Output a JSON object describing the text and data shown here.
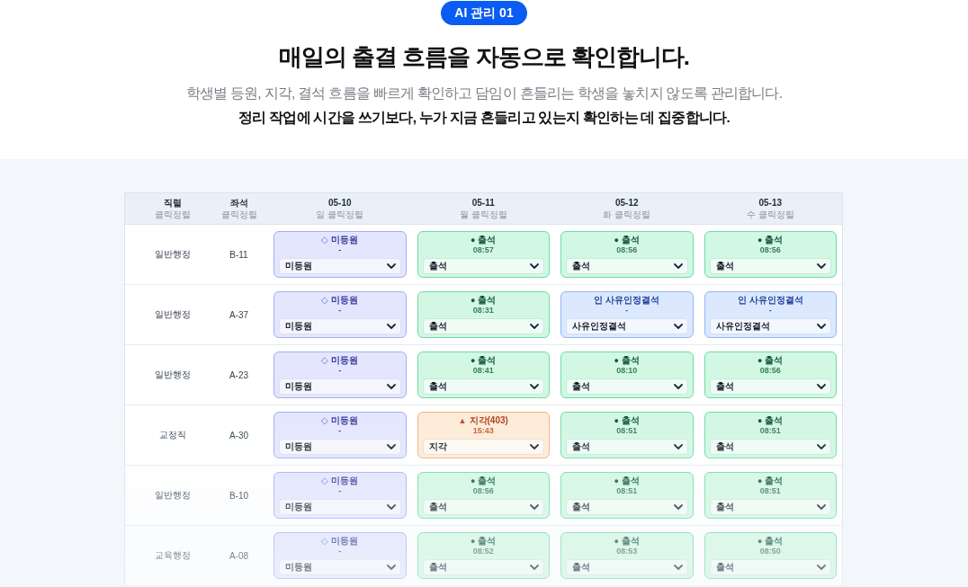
{
  "badge": "AI 관리 01",
  "title": "매일의 출결 흐름을 자동으로 확인합니다.",
  "subtitle": "학생별 등원, 지각, 결석 흐름을 빠르게 확인하고 담임이 흔들리는 학생을 놓치지 않도록 관리합니다.",
  "emphasis": "정리 작업에 시간을 쓰기보다, 누가 지금 흔들리고 있는지 확인하는 데 집중합니다.",
  "table": {
    "columns": [
      {
        "label": "직렬",
        "sub": "클릭정렬"
      },
      {
        "label": "좌석",
        "sub": "클릭정렬"
      },
      {
        "label": "05-10",
        "sub": "일 클릭정렬"
      },
      {
        "label": "05-11",
        "sub": "월 클릭정렬"
      },
      {
        "label": "05-12",
        "sub": "화 클릭정렬"
      },
      {
        "label": "05-13",
        "sub": "수 클릭정렬"
      }
    ],
    "rows": [
      {
        "job_series": "일반행정",
        "seat": "B-11",
        "days": [
          {
            "kind": "pending",
            "mark": "◇",
            "label": "미등원",
            "time": "-",
            "value": "미등원"
          },
          {
            "kind": "present",
            "mark": "●",
            "label": "출석",
            "time": "08:57",
            "value": "출석"
          },
          {
            "kind": "present",
            "mark": "●",
            "label": "출석",
            "time": "08:56",
            "value": "출석"
          },
          {
            "kind": "present",
            "mark": "●",
            "label": "출석",
            "time": "08:56",
            "value": "출석"
          }
        ]
      },
      {
        "job_series": "일반행정",
        "seat": "A-37",
        "days": [
          {
            "kind": "pending",
            "mark": "◇",
            "label": "미등원",
            "time": "-",
            "value": "미등원"
          },
          {
            "kind": "present",
            "mark": "●",
            "label": "출석",
            "time": "08:31",
            "value": "출석"
          },
          {
            "kind": "excused",
            "mark": "인",
            "label": "사유인정결석",
            "time": "-",
            "value": "사유인정결석"
          },
          {
            "kind": "excused",
            "mark": "인",
            "label": "사유인정결석",
            "time": "-",
            "value": "사유인정결석"
          }
        ]
      },
      {
        "job_series": "일반행정",
        "seat": "A-23",
        "days": [
          {
            "kind": "pending",
            "mark": "◇",
            "label": "미등원",
            "time": "-",
            "value": "미등원"
          },
          {
            "kind": "present",
            "mark": "●",
            "label": "출석",
            "time": "08:41",
            "value": "출석"
          },
          {
            "kind": "present",
            "mark": "●",
            "label": "출석",
            "time": "08:10",
            "value": "출석"
          },
          {
            "kind": "present",
            "mark": "●",
            "label": "출석",
            "time": "08:56",
            "value": "출석"
          }
        ]
      },
      {
        "job_series": "교정직",
        "seat": "A-30",
        "days": [
          {
            "kind": "pending",
            "mark": "◇",
            "label": "미등원",
            "time": "-",
            "value": "미등원"
          },
          {
            "kind": "late",
            "mark": "▲",
            "label": "지각(403)",
            "time": "15:43",
            "value": "지각"
          },
          {
            "kind": "present",
            "mark": "●",
            "label": "출석",
            "time": "08:51",
            "value": "출석"
          },
          {
            "kind": "present",
            "mark": "●",
            "label": "출석",
            "time": "08:51",
            "value": "출석"
          }
        ]
      },
      {
        "job_series": "일반행정",
        "seat": "B-10",
        "days": [
          {
            "kind": "pending",
            "mark": "◇",
            "label": "미등원",
            "time": "-",
            "value": "미등원"
          },
          {
            "kind": "present",
            "mark": "●",
            "label": "출석",
            "time": "08:56",
            "value": "출석"
          },
          {
            "kind": "present",
            "mark": "●",
            "label": "출석",
            "time": "08:51",
            "value": "출석"
          },
          {
            "kind": "present",
            "mark": "●",
            "label": "출석",
            "time": "08:51",
            "value": "출석"
          }
        ]
      },
      {
        "job_series": "교육행정",
        "seat": "A-08",
        "days": [
          {
            "kind": "pending",
            "mark": "◇",
            "label": "미등원",
            "time": "-",
            "value": "미등원"
          },
          {
            "kind": "present",
            "mark": "●",
            "label": "출석",
            "time": "08:52",
            "value": "출석"
          },
          {
            "kind": "present",
            "mark": "●",
            "label": "출석",
            "time": "08:53",
            "value": "출석"
          },
          {
            "kind": "present",
            "mark": "●",
            "label": "출석",
            "time": "08:50",
            "value": "출석"
          }
        ]
      }
    ]
  }
}
